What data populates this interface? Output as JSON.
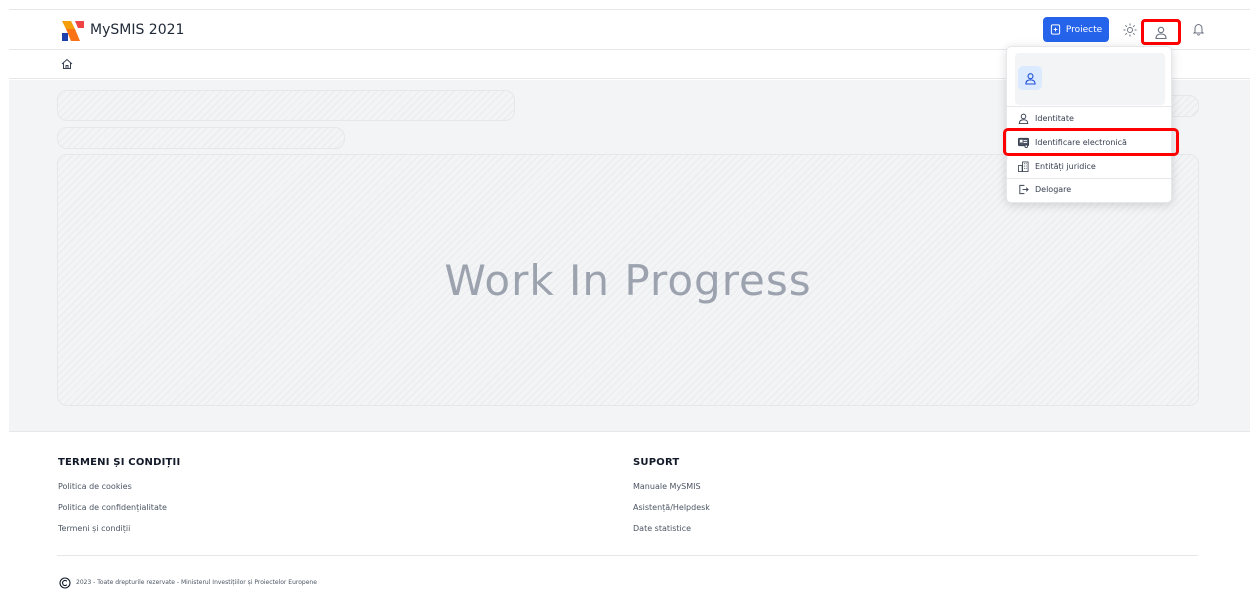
{
  "header": {
    "brand": "MySMIS 2021",
    "projects_button": "Proiecte",
    "colors": {
      "primary": "#2563eb",
      "highlight": "#ff0000"
    },
    "icons": [
      "mysmis-logo-icon",
      "file-plus-icon",
      "sun-icon",
      "user-icon",
      "bell-icon",
      "home-icon"
    ]
  },
  "main": {
    "placeholder": "Work In Progress"
  },
  "user_menu": {
    "items": [
      {
        "label": "Identitate",
        "icon": "user-icon"
      },
      {
        "label": "Identificare electronică",
        "icon": "id-card-icon"
      },
      {
        "label": "Entități juridice",
        "icon": "buildings-icon"
      },
      {
        "label": "Delogare",
        "icon": "logout-icon"
      }
    ]
  },
  "footer": {
    "terms_title": "TERMENI ȘI CONDIȚII",
    "terms_links": [
      "Politica de cookies",
      "Politica de confidențialitate",
      "Termeni și condiții"
    ],
    "support_title": "SUPORT",
    "support_links": [
      "Manuale MySMIS",
      "Asistență/Helpdesk",
      "Date statistice"
    ],
    "copyright": "2023 - Toate drepturile rezervate - Ministerul Investițiilor și Proiectelor Europene"
  }
}
